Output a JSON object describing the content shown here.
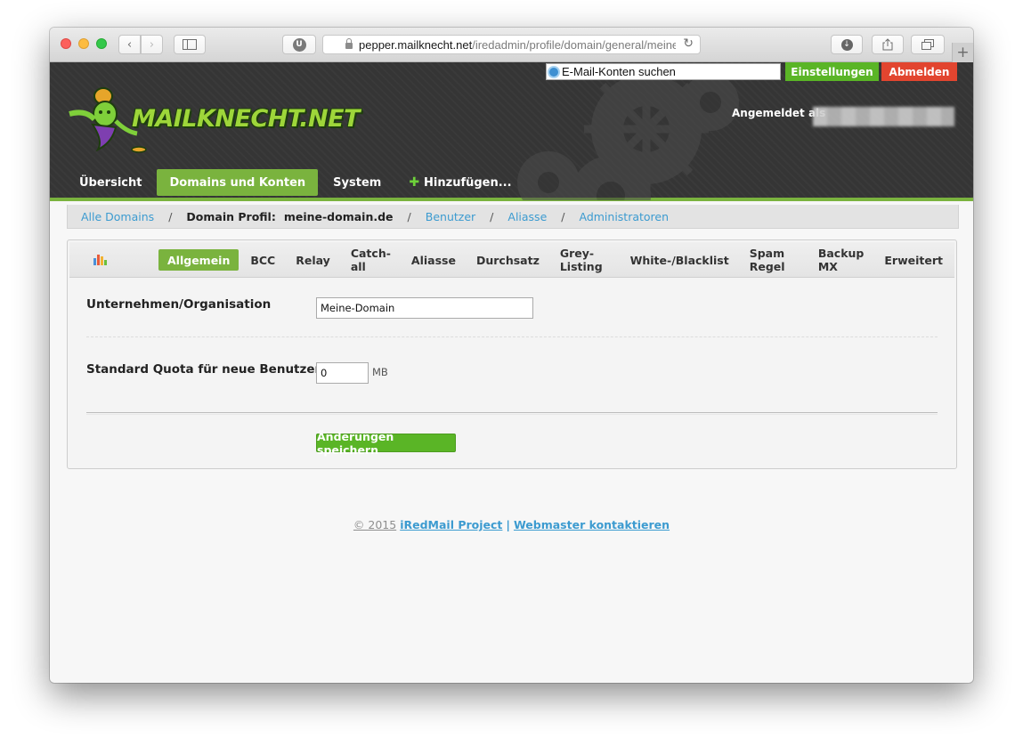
{
  "browser": {
    "url_host": "pepper.mailknecht.net",
    "url_path": "/iredadmin/profile/domain/general/meine-domain.de"
  },
  "header": {
    "search_placeholder": "E-Mail-Konten suchen",
    "settings_label": "Einstellungen",
    "logout_label": "Abmelden",
    "logged_in_label": "Angemeldet als",
    "logo_text": "MAILKNECHT.NET",
    "nav": [
      {
        "label": "Übersicht"
      },
      {
        "label": "Domains und Konten"
      },
      {
        "label": "System"
      },
      {
        "label": "Hinzufügen..."
      }
    ]
  },
  "breadcrumb": {
    "all_domains": "Alle Domains",
    "separator": "/",
    "current_label": "Domain Profil:",
    "current_domain": "meine-domain.de",
    "users": "Benutzer",
    "aliases": "Aliasse",
    "admins": "Administratoren"
  },
  "tabs": [
    {
      "label": "Allgemein"
    },
    {
      "label": "BCC"
    },
    {
      "label": "Relay"
    },
    {
      "label": "Catch-all"
    },
    {
      "label": "Aliasse"
    },
    {
      "label": "Durchsatz"
    },
    {
      "label": "Grey-Listing"
    },
    {
      "label": "White-/Blacklist"
    },
    {
      "label": "Spam Regel"
    },
    {
      "label": "Backup MX"
    },
    {
      "label": "Erweitert"
    }
  ],
  "form": {
    "org_label": "Unternehmen/Organisation",
    "org_value": "Meine-Domain",
    "quota_label": "Standard Quota für neue Benutzer",
    "quota_value": "0",
    "quota_unit": "MB",
    "save_label": "Änderungen speichern"
  },
  "footer": {
    "copyright": "© 2015",
    "project": "iRedMail Project",
    "divider": "|",
    "contact": "Webmaster kontaktieren"
  },
  "colors": {
    "accent_green": "#7ab33e",
    "button_green": "#5ab526",
    "logout_red": "#e2452f",
    "link_blue": "#3c9bd0",
    "header_dark": "#353535"
  }
}
